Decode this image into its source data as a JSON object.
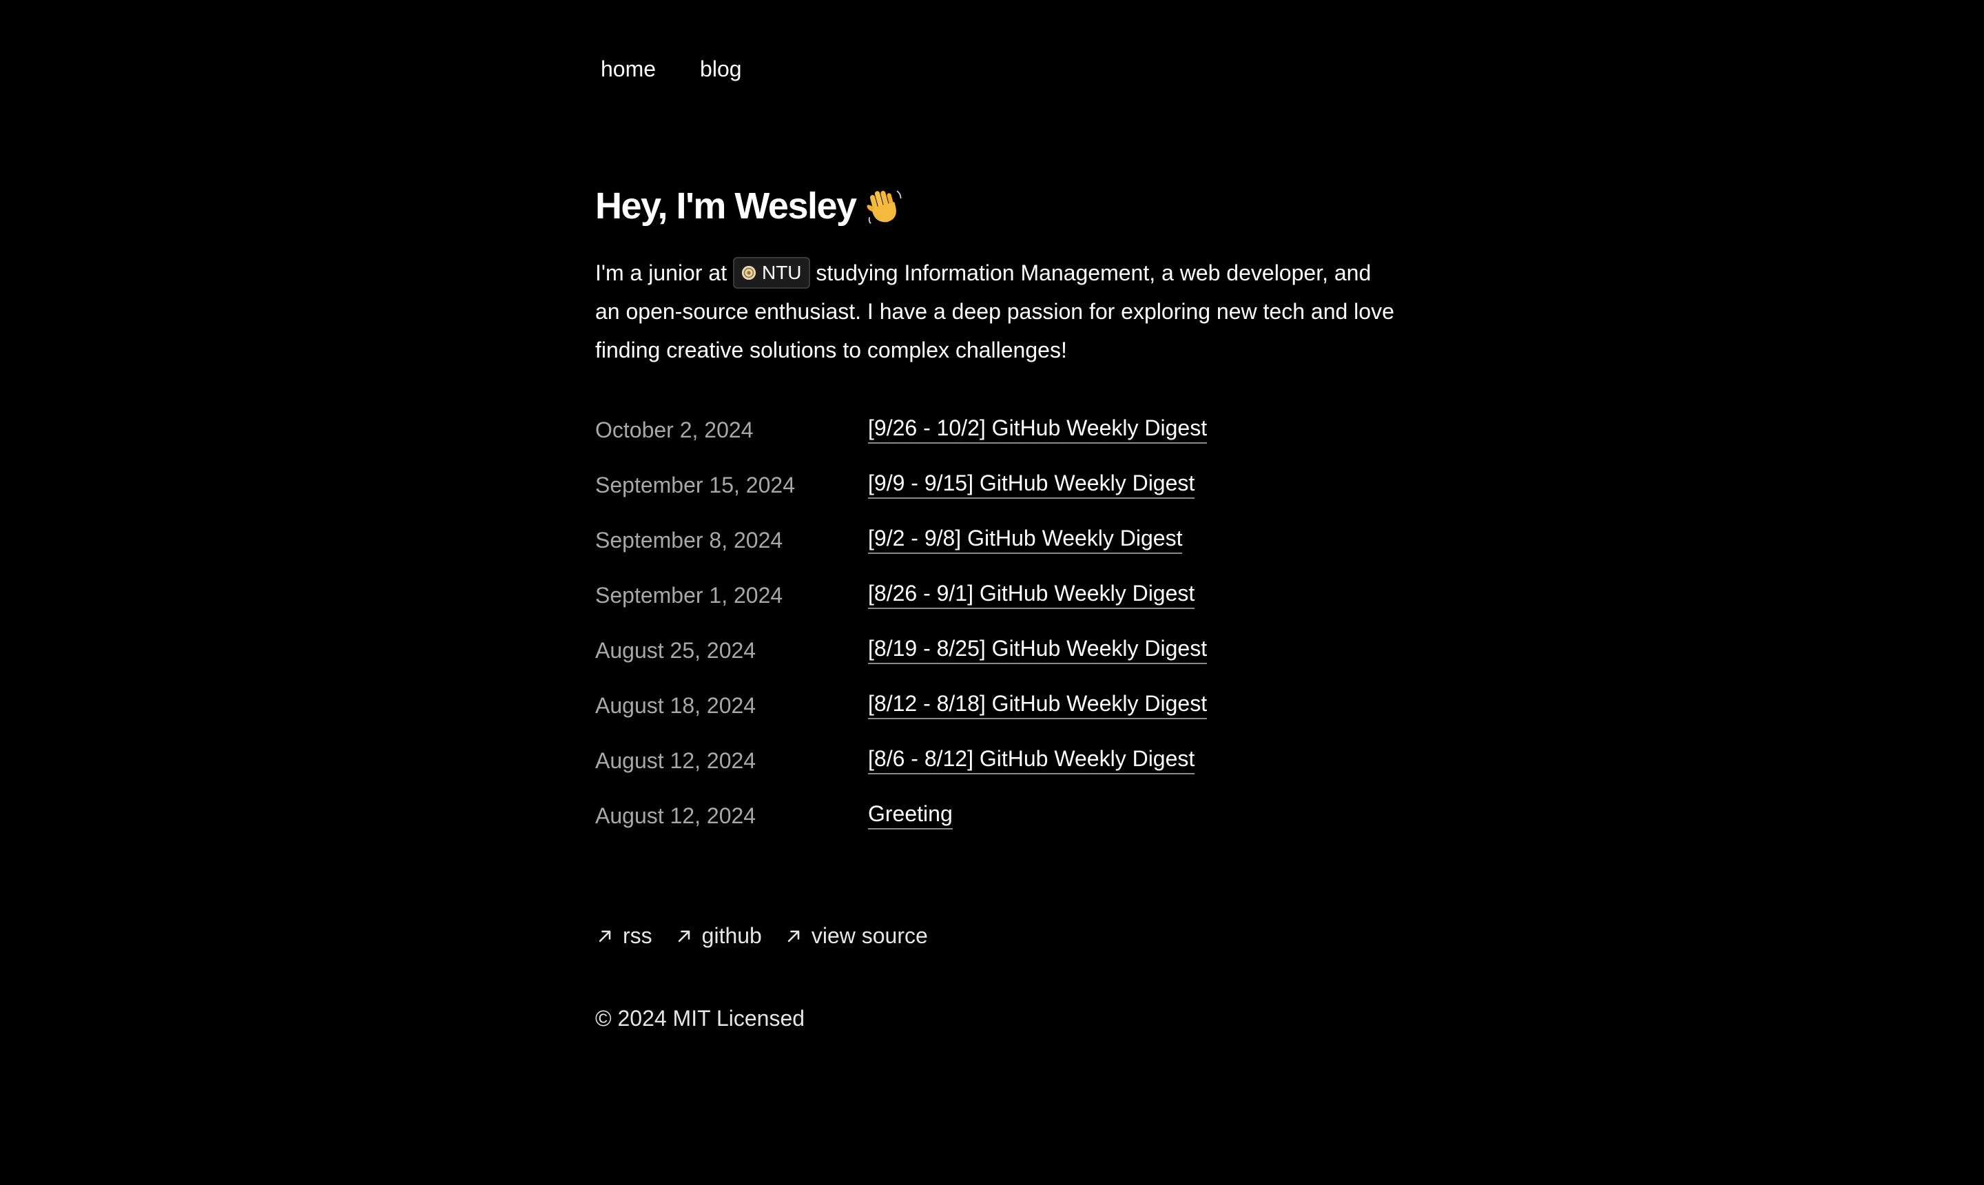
{
  "nav": {
    "items": [
      {
        "label": "home"
      },
      {
        "label": "blog"
      }
    ]
  },
  "heading": {
    "text": "Hey, I'm Wesley",
    "emoji_icon": "waving-hand-icon"
  },
  "intro": {
    "before_badge": "I'm a junior at ",
    "badge_label": "NTU",
    "badge_icon": "ntu-logo-icon",
    "after_badge": " studying Information Management, a web developer, and an open-source enthusiast. I have a deep passion for exploring new tech and love finding creative solutions to complex challenges!"
  },
  "posts": [
    {
      "date": "October 2, 2024",
      "title": "[9/26 - 10/2] GitHub Weekly Digest"
    },
    {
      "date": "September 15, 2024",
      "title": "[9/9 - 9/15] GitHub Weekly Digest"
    },
    {
      "date": "September 8, 2024",
      "title": "[9/2 - 9/8] GitHub Weekly Digest"
    },
    {
      "date": "September 1, 2024",
      "title": "[8/26 - 9/1] GitHub Weekly Digest"
    },
    {
      "date": "August 25, 2024",
      "title": "[8/19 - 8/25] GitHub Weekly Digest"
    },
    {
      "date": "August 18, 2024",
      "title": "[8/12 - 8/18] GitHub Weekly Digest"
    },
    {
      "date": "August 12, 2024",
      "title": "[8/6 - 8/12] GitHub Weekly Digest"
    },
    {
      "date": "August 12, 2024",
      "title": "Greeting"
    }
  ],
  "footer": {
    "links": [
      {
        "label": "rss",
        "icon": "arrow-up-right-icon"
      },
      {
        "label": "github",
        "icon": "arrow-up-right-icon"
      },
      {
        "label": "view source",
        "icon": "arrow-up-right-icon"
      }
    ],
    "copyright": "© 2024 MIT Licensed"
  },
  "colors": {
    "background": "#000000",
    "text": "#ffffff",
    "muted": "#a8a8a8",
    "badge_bg": "#1c1c1c"
  }
}
